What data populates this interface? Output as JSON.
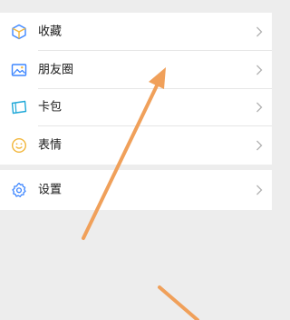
{
  "menu": {
    "group1": [
      {
        "label": "收藏",
        "icon": "favorites-cube-icon"
      },
      {
        "label": "朋友圈",
        "icon": "moments-image-icon"
      },
      {
        "label": "卡包",
        "icon": "card-wallet-icon"
      },
      {
        "label": "表情",
        "icon": "emoji-smile-icon"
      }
    ],
    "group2": [
      {
        "label": "设置",
        "icon": "settings-gear-icon"
      }
    ],
    "chevron_icon": "chevron-right-icon"
  },
  "colors": {
    "background": "#ededed",
    "panel": "#ffffff",
    "divider": "#e6e6e6",
    "label": "#1a1a1a",
    "chevron": "#b2b2b2",
    "annotation_arrow": "#f0a05a",
    "icon_blue": "#3d86ff",
    "icon_yellow": "#f2b63b",
    "icon_teal": "#1fa8d8"
  }
}
